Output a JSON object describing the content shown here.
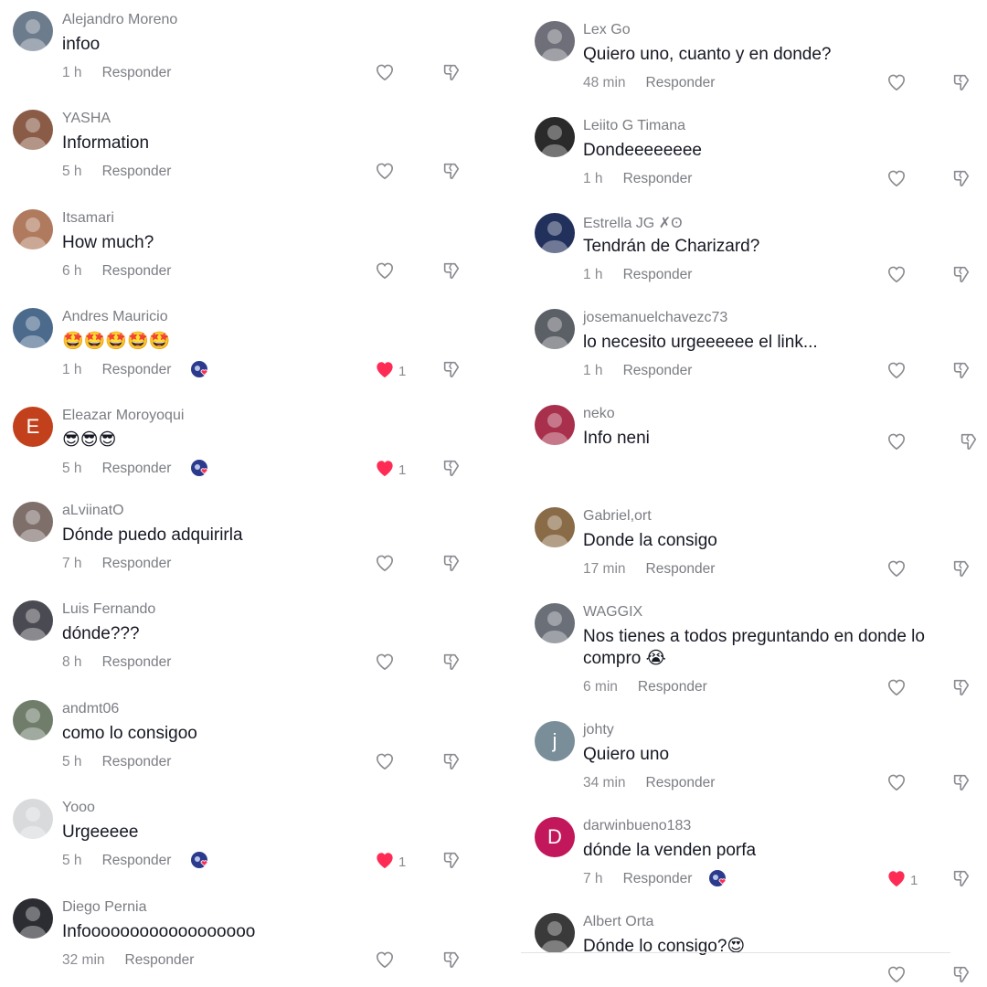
{
  "left_comments": [
    {
      "user": "Alejandro Moreno",
      "text": "infoo",
      "time": "1 h",
      "reply": "Responder",
      "liked": false,
      "likes": "",
      "creator_liked": false,
      "avatar": "#6d7c8c"
    },
    {
      "user": "YASHA",
      "text": "Information",
      "time": "5 h",
      "reply": "Responder",
      "liked": false,
      "likes": "",
      "creator_liked": false,
      "avatar": "#8a5c48"
    },
    {
      "user": "Itsamari",
      "text": "How much?",
      "time": "6 h",
      "reply": "Responder",
      "liked": false,
      "likes": "",
      "creator_liked": false,
      "avatar": "#b07a5e"
    },
    {
      "user": "Andres Mauricio",
      "text": "🤩🤩🤩🤩🤩",
      "time": "1 h",
      "reply": "Responder",
      "liked": true,
      "likes": "1",
      "creator_liked": true,
      "avatar": "#4b6a8c"
    },
    {
      "user": "Eleazar Moroyoqui",
      "text": "😎😎😎",
      "time": "5 h",
      "reply": "Responder",
      "liked": true,
      "likes": "1",
      "creator_liked": true,
      "avatar": "#c2411c",
      "initial": "E"
    },
    {
      "user": "aLviinatO",
      "text": "Dónde puedo adquirirla",
      "time": "7 h",
      "reply": "Responder",
      "liked": false,
      "likes": "",
      "creator_liked": false,
      "avatar": "#7e6f6a"
    },
    {
      "user": "Luis Fernando",
      "text": "dónde???",
      "time": "8 h",
      "reply": "Responder",
      "liked": false,
      "likes": "",
      "creator_liked": false,
      "avatar": "#4a4a52"
    },
    {
      "user": "andmt06",
      "text": "como lo consigoo",
      "time": "5 h",
      "reply": "Responder",
      "liked": false,
      "likes": "",
      "creator_liked": false,
      "avatar": "#6f7d6a"
    },
    {
      "user": "Yooo",
      "text": "Urgeeeee",
      "time": "5 h",
      "reply": "Responder",
      "liked": true,
      "likes": "1",
      "creator_liked": true,
      "avatar": "#d9dadc"
    },
    {
      "user": "Diego Pernia",
      "text": "Infoooooooooooooooooo",
      "time": "32 min",
      "reply": "Responder",
      "liked": false,
      "likes": "",
      "creator_liked": false,
      "avatar": "#2c2d33"
    }
  ],
  "right_comments": [
    {
      "user": "Lex Go",
      "text": "Quiero uno, cuanto y en donde?",
      "time": "48 min",
      "reply": "Responder",
      "liked": false,
      "likes": "",
      "creator_liked": false,
      "avatar": "#6e6f78"
    },
    {
      "user": "Leiito G Timana",
      "text": "Dondeeeeeeee",
      "time": "1 h",
      "reply": "Responder",
      "liked": false,
      "likes": "",
      "creator_liked": false,
      "avatar": "#2a2a2a"
    },
    {
      "user": "Estrella JG ✗ʘ",
      "text": "Tendrán de Charizard?",
      "time": "1 h",
      "reply": "Responder",
      "liked": false,
      "likes": "",
      "creator_liked": false,
      "avatar": "#22305c"
    },
    {
      "user": "josemanuelchavezc73",
      "text": "lo necesito urgeeeeee el link...",
      "time": "1 h",
      "reply": "Responder",
      "liked": false,
      "likes": "",
      "creator_liked": false,
      "avatar": "#5b5f66"
    },
    {
      "user": "neko",
      "text": "Info neni",
      "time": "",
      "reply": "",
      "liked": false,
      "likes": "",
      "creator_liked": false,
      "avatar": "#a8304c"
    },
    {
      "user": "Gabriel,ort",
      "text": "Donde la consigo",
      "time": "17 min",
      "reply": "Responder",
      "liked": false,
      "likes": "",
      "creator_liked": false,
      "avatar": "#8a6b48"
    },
    {
      "user": "WAGGIX",
      "text": "Nos tienes a todos preguntando en donde lo compro 😭",
      "time": "6 min",
      "reply": "Responder",
      "liked": false,
      "likes": "",
      "creator_liked": false,
      "avatar": "#6a6f78"
    },
    {
      "user": "johty",
      "text": "Quiero uno",
      "time": "34 min",
      "reply": "Responder",
      "liked": false,
      "likes": "",
      "creator_liked": false,
      "avatar": "#7a8e99",
      "initial": "j"
    },
    {
      "user": "darwinbueno183",
      "text": "dónde la venden porfa",
      "time": "7 h",
      "reply": "Responder",
      "liked": true,
      "likes": "1",
      "creator_liked": true,
      "avatar": "#c2185b",
      "initial": "D"
    },
    {
      "user": "Albert Orta",
      "text": "Dónde lo consigo?😍",
      "time": "",
      "reply": "",
      "liked": false,
      "likes": "",
      "creator_liked": false,
      "avatar": "#3a3a3a"
    }
  ],
  "colors": {
    "liked": "#fe2c55",
    "icon": "#8a8b91"
  }
}
